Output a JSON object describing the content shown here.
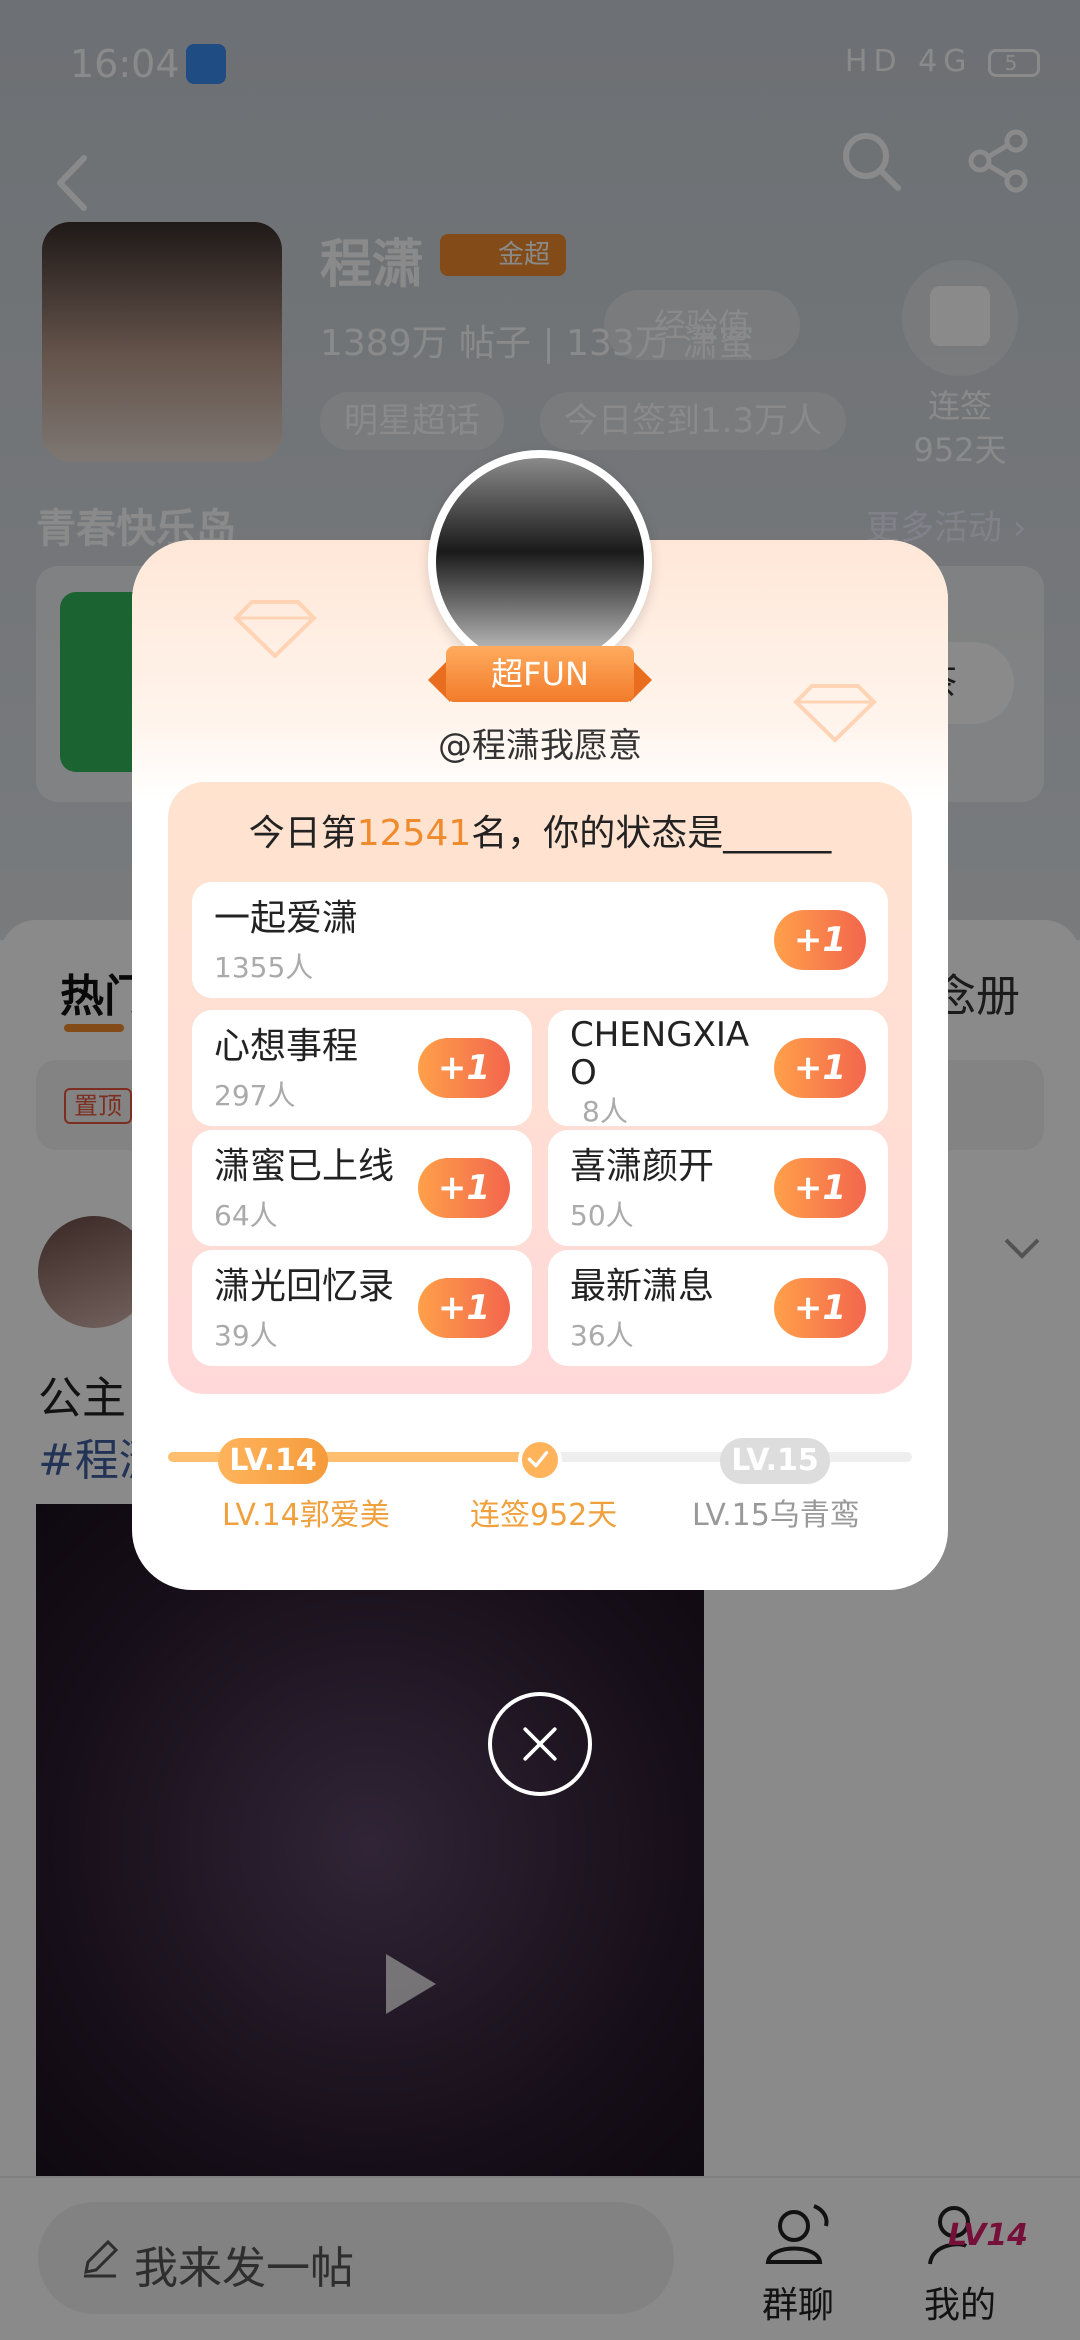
{
  "status": {
    "time": "16:04",
    "network": "HD 4G",
    "battery": "5"
  },
  "profile": {
    "name": "程潇",
    "badge": "金超",
    "stats": "1389万 帖子 | 133万 潇蜜",
    "exp_label": "经验值",
    "chips": [
      "明星超话",
      "今日签到1.3万人"
    ],
    "checkin_label": "连签",
    "checkin_days": "952天"
  },
  "island": {
    "title": "青春快乐岛",
    "more": "更多活动 ›",
    "button": "茶"
  },
  "tabs": {
    "hot": "热门",
    "right": "念册",
    "pin": "置顶"
  },
  "post": {
    "text1": "公主",
    "text2": "#程潇"
  },
  "bottom": {
    "compose": "我来发一帖",
    "nav_chat": "群聊",
    "nav_mine": "我的",
    "lv_tag": "LV14"
  },
  "modal": {
    "ribbon": "超FUN",
    "handle": "@程潇我愿意",
    "rank_prefix": "今日第",
    "rank_number": "12541",
    "rank_suffix": "名，你的状态是______",
    "plus_label": "+1",
    "options": [
      {
        "label": "一起爱潇",
        "count": "1355人"
      },
      {
        "label": "心想事程",
        "count": "297人"
      },
      {
        "label": "CHENGXIAO",
        "count": "8人"
      },
      {
        "label": "潇蜜已上线",
        "count": "64人"
      },
      {
        "label": "喜潇颜开",
        "count": "50人"
      },
      {
        "label": "潇光回忆录",
        "count": "39人"
      },
      {
        "label": "最新潇息",
        "count": "36人"
      }
    ],
    "level": {
      "current_pill": "LV.14",
      "next_pill": "LV.15",
      "current_caption": "LV.14郭爱美",
      "mid_caption": "连签952天",
      "next_caption": "LV.15乌青鸾",
      "progress": 0.5
    }
  }
}
